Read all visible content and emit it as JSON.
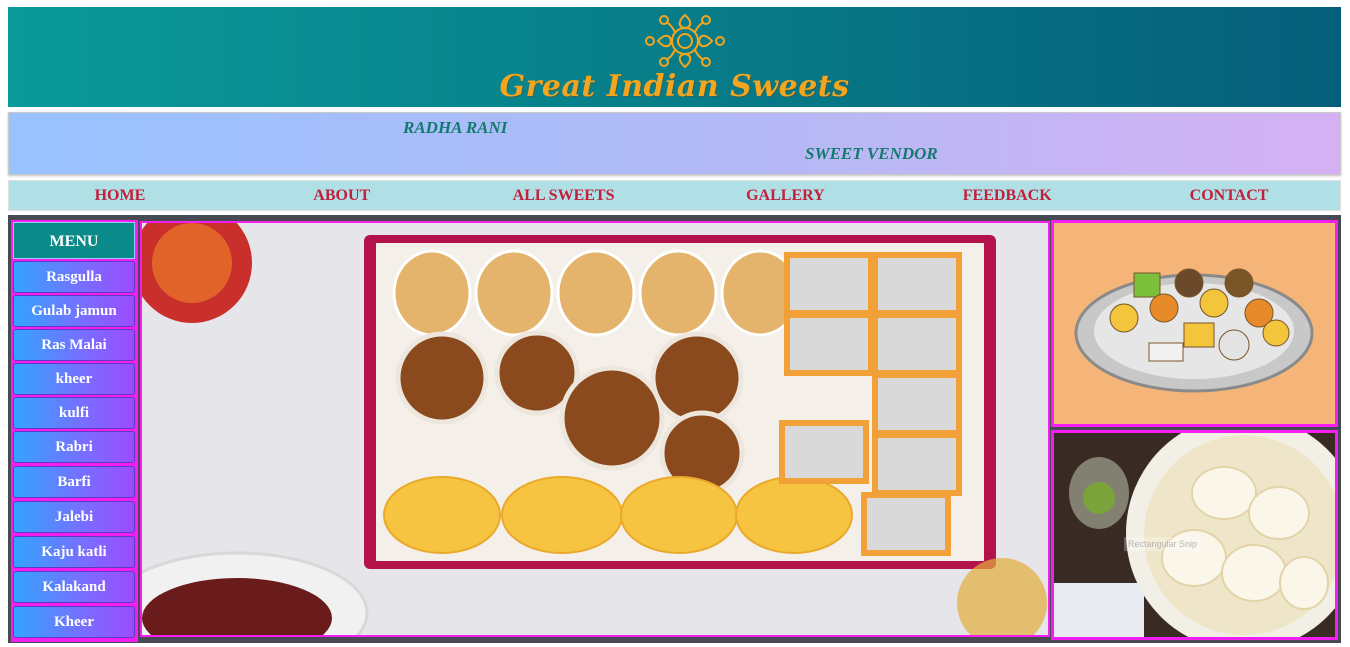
{
  "header": {
    "brand": "Great Indian Sweets"
  },
  "marquee": {
    "line1": "RADHA RANI",
    "line2": "SWEET VENDOR"
  },
  "nav": {
    "items": [
      {
        "label": "HOME"
      },
      {
        "label": "ABOUT"
      },
      {
        "label": "ALL SWEETS"
      },
      {
        "label": "GALLERY"
      },
      {
        "label": "FEEDBACK"
      },
      {
        "label": "CONTACT"
      }
    ]
  },
  "menu": {
    "title": "MENU",
    "items": [
      "Rasgulla",
      "Gulab jamun",
      "Ras Malai",
      "kheer",
      "kulfi",
      "Rabri",
      "Barfi",
      "Jalebi",
      "Kaju katli",
      "Kalakand",
      "Kheer"
    ]
  },
  "images": {
    "main": "sweets-box-image",
    "side1": "sweets-plate-image",
    "side2": "rasmalai-bowl-image",
    "side2_watermark": "Rectangular Snip"
  },
  "colors": {
    "banner_start": "#0a9a9a",
    "banner_end": "#055e7a",
    "brand_text": "#f3a51f",
    "nav_bg": "#b0e0e6",
    "nav_text": "#c21f3a",
    "marquee_text": "#137a6e",
    "frame_magenta": "#f41ef0",
    "menu_head": "#0b8a8a"
  }
}
